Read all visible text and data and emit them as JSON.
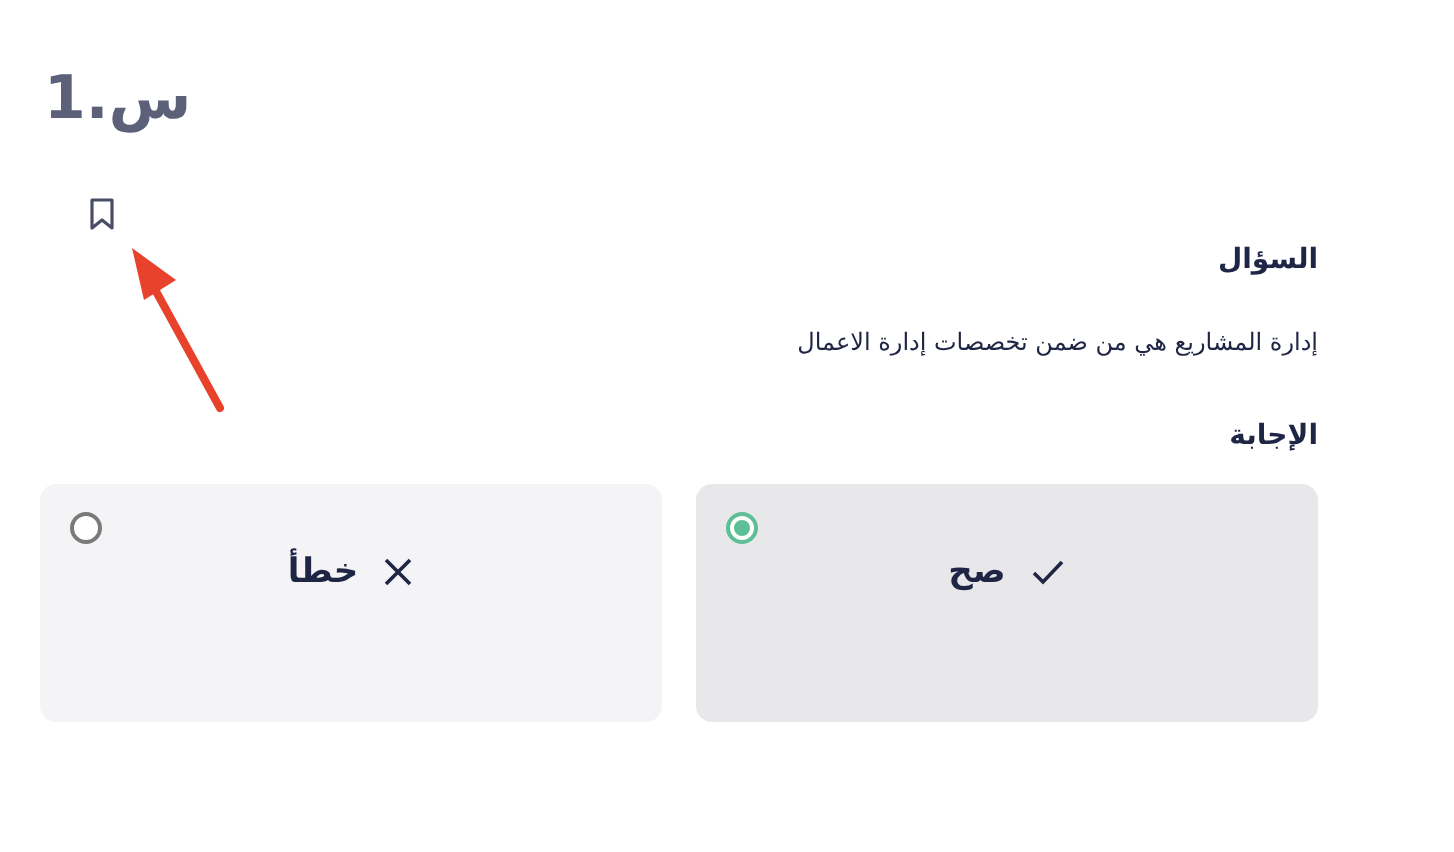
{
  "title": "س.1",
  "question_label": "السؤال",
  "question": "إدارة المشاريع هي من ضمن تخصصات إدارة الاعمال",
  "answer_label": "الإجابة",
  "options": [
    {
      "kind": "true",
      "label": "صح",
      "selected": true
    },
    {
      "kind": "false",
      "label": "خطأ",
      "selected": false
    }
  ]
}
